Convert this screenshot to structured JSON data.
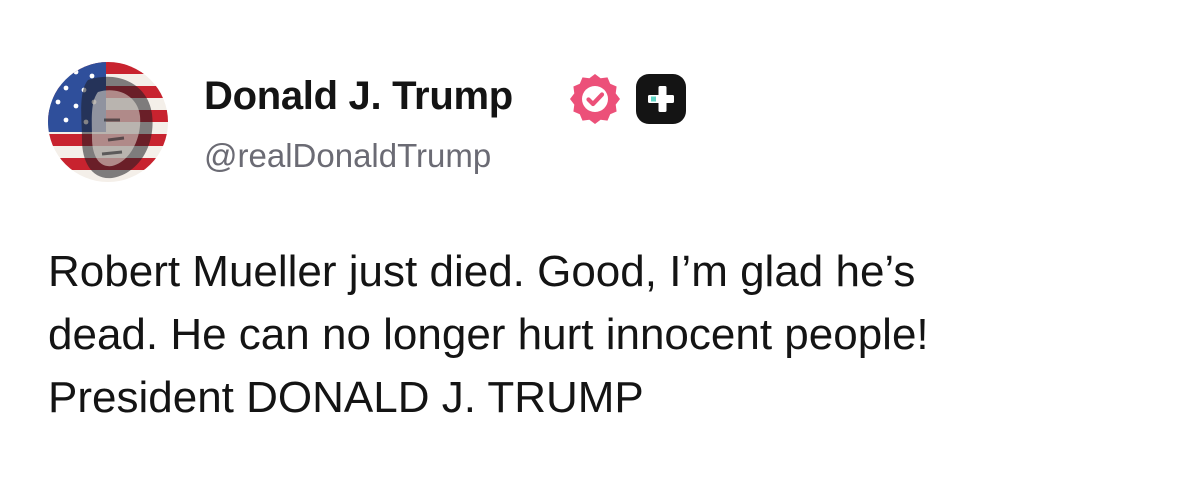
{
  "author": {
    "display_name": "Donald J. Trump",
    "handle": "@realDonaldTrump",
    "avatar": "flag-portrait-avatar",
    "verified_icon": "verified-badge-icon",
    "verified_color": "#ec5079",
    "plus_icon": "plus-badge-icon",
    "plus_color": "#141414",
    "plus_accent": "#5fd4c4"
  },
  "post": {
    "lines": [
      "Robert Mueller just died. Good, I’m glad he’s",
      "dead. He can no longer hurt innocent people!",
      "President DONALD J. TRUMP"
    ]
  }
}
